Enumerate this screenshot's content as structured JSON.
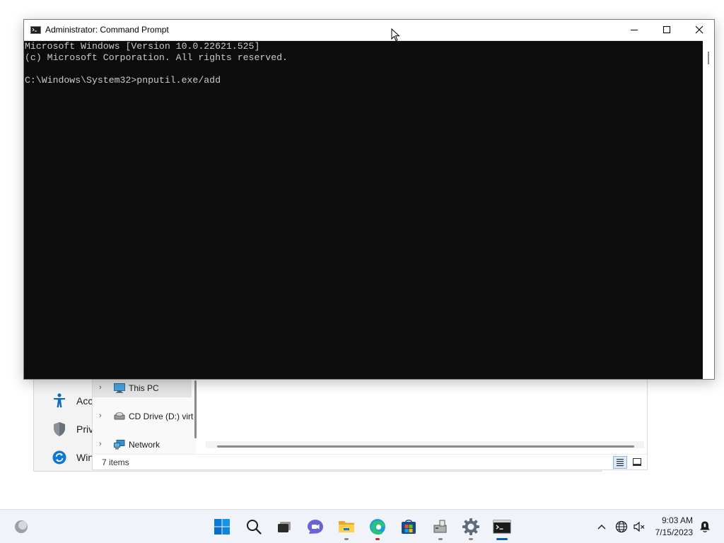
{
  "cmd": {
    "title": "Administrator: Command Prompt",
    "lines": [
      "Microsoft Windows [Version 10.0.22621.525]",
      "(c) Microsoft Corporation. All rights reserved.",
      "",
      "C:\\Windows\\System32>pnputil.exe/add"
    ]
  },
  "settings": {
    "items": [
      {
        "label": "Acc",
        "icon": "accessibility-icon"
      },
      {
        "label": "Priv",
        "icon": "shield-icon"
      },
      {
        "label": "Win",
        "icon": "windows-update-icon"
      }
    ]
  },
  "explorer": {
    "nav_items": [
      {
        "label": "This PC",
        "icon": "pc-icon",
        "selected": true
      },
      {
        "label": "CD Drive (D:) virt",
        "icon": "cd-drive-icon",
        "selected": false
      },
      {
        "label": "Network",
        "icon": "network-icon",
        "selected": false
      }
    ],
    "status_text": "7 items"
  },
  "taskbar": {
    "clock_time": "9:03 AM",
    "clock_date": "7/15/2023",
    "apps": [
      "start",
      "search",
      "task-view",
      "teams-chat",
      "file-explorer",
      "edge",
      "microsoft-store",
      "device-setup",
      "settings",
      "command-prompt"
    ]
  },
  "colors": {
    "console_bg": "#0c0c0c",
    "console_fg": "#cccccc",
    "accent": "#005fb8"
  }
}
